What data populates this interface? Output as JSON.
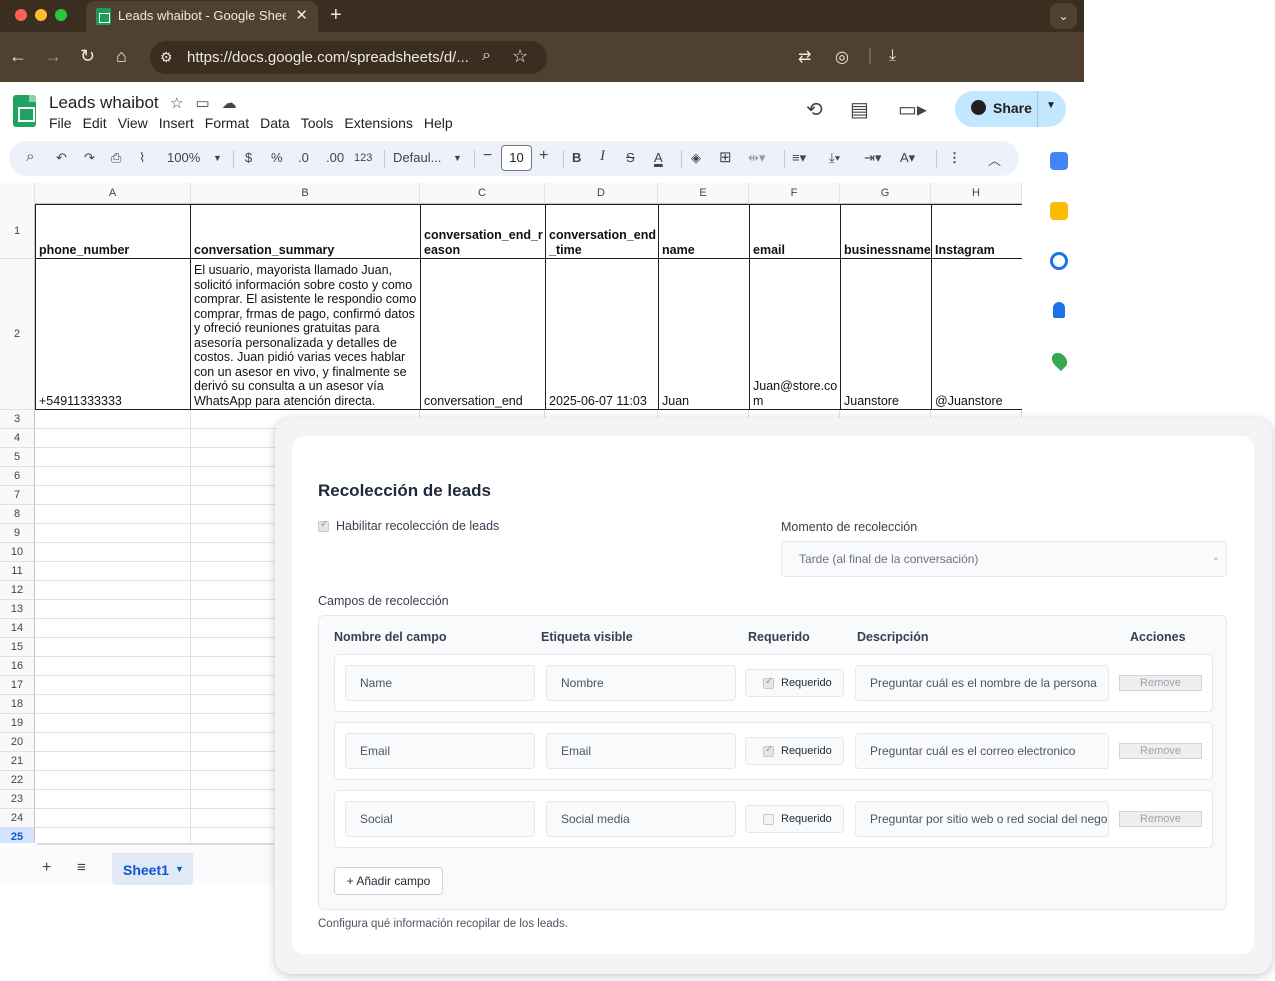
{
  "browser": {
    "tab_title": "Leads whaibot - Google Sheets",
    "new_tab": "+",
    "tab_close": "✕",
    "url": "https://docs.google.com/spreadsheets/d/..."
  },
  "sheets": {
    "doc_title": "Leads whaibot",
    "menu": [
      "File",
      "Edit",
      "View",
      "Insert",
      "Format",
      "Data",
      "Tools",
      "Extensions",
      "Help"
    ],
    "share_label": "Share",
    "toolbar": {
      "zoom": "100%",
      "currency": "$",
      "percent": "%",
      "decimal_decrease": ".0",
      "decimal_increase": ".00",
      "number_format": "123",
      "font": "Defaul...",
      "font_size": "10"
    },
    "columns": [
      "A",
      "B",
      "C",
      "D",
      "E",
      "F",
      "G",
      "H"
    ],
    "row_numbers": [
      "1",
      "2",
      "3",
      "4",
      "5",
      "6",
      "7",
      "8",
      "9",
      "10",
      "11",
      "12",
      "13",
      "14",
      "15",
      "16",
      "17",
      "18",
      "19",
      "20",
      "21",
      "22",
      "23",
      "24",
      "25"
    ],
    "header_row": [
      "phone_number",
      "conversation_summary",
      "conversation_end_r eason",
      "conversation_end _time",
      "name",
      "email",
      "businessname",
      "Instagram"
    ],
    "data_row": [
      "+54911333333",
      "El usuario, mayorista llamado Juan, solicitó información sobre costo y como comprar. El asistente le respondio como comprar, frmas de pago, confirmó datos y ofreció reuniones gratuitas para asesoría personalizada y detalles de costos. Juan pidió varias veces hablar con un asesor en vivo, y finalmente se derivó su consulta a un asesor vía WhatsApp para atención directa.",
      "conversation_end",
      "2025-06-07 11:03",
      "Juan",
      "Juan@store.co m",
      "Juanstore",
      "@Juanstore"
    ],
    "sheet_tab": "Sheet1"
  },
  "leads_form": {
    "title": "Recolección de leads",
    "enable_label": "Habilitar recolección de leads",
    "enable_checked": true,
    "moment_label": "Momento de recolección",
    "moment_value": "Tarde (al final de la conversación)",
    "fields_label": "Campos de recolección",
    "columns": {
      "name": "Nombre del campo",
      "label": "Etiqueta visible",
      "required": "Requerido",
      "description": "Descripción",
      "actions": "Acciones"
    },
    "rows": [
      {
        "name": "Name",
        "label": "Nombre",
        "required": true,
        "required_label": "Requerido",
        "description": "Preguntar cuál es el nombre de la persona",
        "remove": "Remove"
      },
      {
        "name": "Email",
        "label": "Email",
        "required": true,
        "required_label": "Requerido",
        "description": "Preguntar cuál es el correo electronico",
        "remove": "Remove"
      },
      {
        "name": "Social",
        "label": "Social media",
        "required": false,
        "required_label": "Requerido",
        "description": "Preguntar por sitio web o red social del negocio",
        "remove": "Remove"
      }
    ],
    "add_field": "+ Añadir campo",
    "help_text": "Configura qué información recopilar de los leads."
  }
}
